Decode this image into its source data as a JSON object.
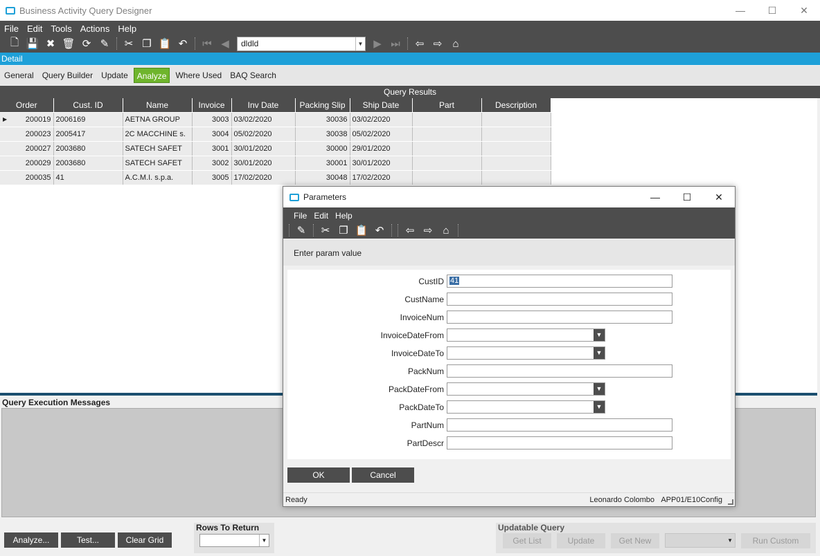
{
  "app": {
    "title": "Business Activity Query Designer",
    "menu": [
      "File",
      "Edit",
      "Tools",
      "Actions",
      "Help"
    ],
    "toolbar_combo_value": "dldld",
    "detail_label": "Detail",
    "tabs": [
      "General",
      "Query Builder",
      "Update",
      "Analyze",
      "Where Used",
      "BAQ Search"
    ],
    "active_tab": "Analyze"
  },
  "results": {
    "title": "Query Results",
    "columns": [
      "Order",
      "Cust. ID",
      "Name",
      "Invoice",
      "Inv Date",
      "Packing Slip",
      "Ship Date",
      "Part",
      "Description"
    ],
    "rows": [
      [
        "200019",
        "2006169",
        "AETNA GROUP",
        "3003",
        "03/02/2020",
        "30036",
        "03/02/2020",
        "",
        ""
      ],
      [
        "200023",
        "2005417",
        "2C MACCHINE s.",
        "3004",
        "05/02/2020",
        "30038",
        "05/02/2020",
        "",
        ""
      ],
      [
        "200027",
        "2003680",
        "SATECH SAFET",
        "3001",
        "30/01/2020",
        "30000",
        "29/01/2020",
        "",
        ""
      ],
      [
        "200029",
        "2003680",
        "SATECH SAFET",
        "3002",
        "30/01/2020",
        "30001",
        "30/01/2020",
        "",
        ""
      ],
      [
        "200035",
        "41",
        "A.C.M.I. s.p.a.",
        "3005",
        "17/02/2020",
        "30048",
        "17/02/2020",
        "",
        ""
      ]
    ]
  },
  "messages": {
    "label": "Query Execution Messages"
  },
  "bottom": {
    "analyze": "Analyze...",
    "test": "Test...",
    "clear_grid": "Clear Grid",
    "rows_to_return": "Rows To Return",
    "updatable_query": "Updatable Query",
    "get_list": "Get List",
    "update": "Update",
    "get_new": "Get New",
    "run_custom": "Run Custom"
  },
  "dialog": {
    "title": "Parameters",
    "menu": [
      "File",
      "Edit",
      "Help"
    ],
    "prompt": "Enter param value",
    "fields": [
      {
        "label": "CustID",
        "type": "text",
        "value": "41"
      },
      {
        "label": "CustName",
        "type": "text",
        "value": ""
      },
      {
        "label": "InvoiceNum",
        "type": "text",
        "value": ""
      },
      {
        "label": "InvoiceDateFrom",
        "type": "select",
        "value": ""
      },
      {
        "label": "InvoiceDateTo",
        "type": "select",
        "value": ""
      },
      {
        "label": "PackNum",
        "type": "text",
        "value": ""
      },
      {
        "label": "PackDateFrom",
        "type": "select",
        "value": ""
      },
      {
        "label": "PackDateTo",
        "type": "select",
        "value": ""
      },
      {
        "label": "PartNum",
        "type": "text",
        "value": ""
      },
      {
        "label": "PartDescr",
        "type": "text",
        "value": ""
      }
    ],
    "ok": "OK",
    "cancel": "Cancel",
    "status": "Ready",
    "user": "Leonardo Colombo",
    "config": "APP01/E10Config"
  },
  "colors": {
    "accent": "#1ea0d8",
    "active_tab": "#6fb52c",
    "dark": "#4d4d4d"
  }
}
